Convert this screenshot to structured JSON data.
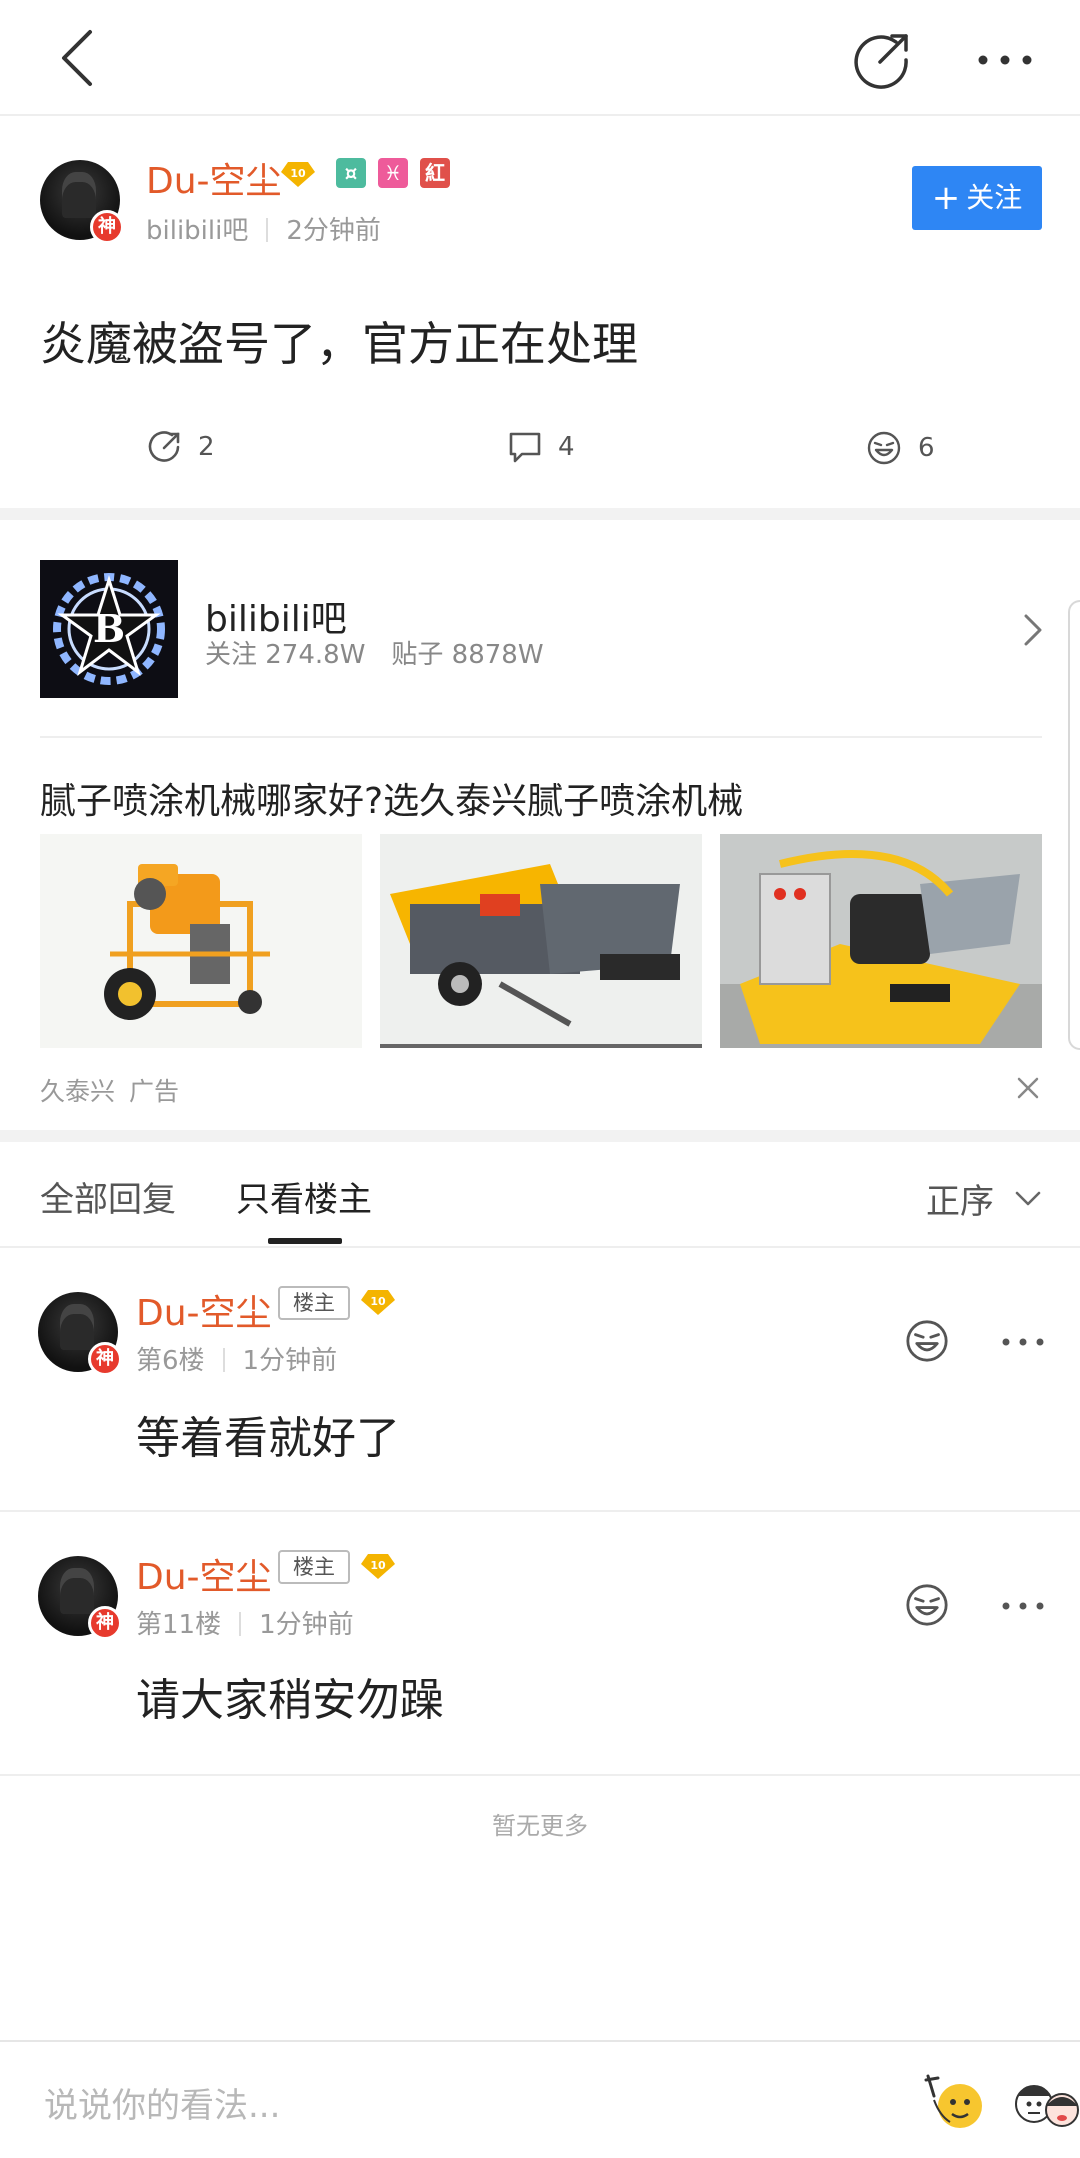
{
  "header": {
    "back_icon": "back-arrow-icon",
    "share_icon": "share-icon",
    "more_icon": "more-dots-icon"
  },
  "post": {
    "author": "Du-空尘",
    "level": "10",
    "tags": [
      "¤",
      "♓",
      "紅"
    ],
    "avatar_badge": "神",
    "forum": "bilibili吧",
    "time": "2分钟前",
    "follow_label": "关注",
    "follow_plus": "+",
    "title": "炎魔被盗号了，官方正在处理",
    "shares": "2",
    "comments": "4",
    "likes": "6"
  },
  "forum_card": {
    "name": "bilibili吧",
    "followers": "关注 274.8W",
    "posts": "贴子 8878W"
  },
  "ad": {
    "title": "腻子喷涂机械哪家好?选久泰兴腻子喷涂机械",
    "advertiser": "久泰兴",
    "label": "广告"
  },
  "tabs": {
    "all": "全部回复",
    "owner_only": "只看楼主",
    "sort": "正序"
  },
  "replies": [
    {
      "author": "Du-空尘",
      "owner_tag": "楼主",
      "level": "10",
      "avatar_badge": "神",
      "floor": "第6楼",
      "time": "1分钟前",
      "text": "等着看就好了"
    },
    {
      "author": "Du-空尘",
      "owner_tag": "楼主",
      "level": "10",
      "avatar_badge": "神",
      "floor": "第11楼",
      "time": "1分钟前",
      "text": "请大家稍安勿躁"
    }
  ],
  "no_more": "暂无更多",
  "composer": {
    "placeholder": "说说你的看法..."
  },
  "colors": {
    "username": "#e25a2a",
    "follow_button": "#2e86f4",
    "tag_green": "#4dbb9e",
    "tag_pink": "#ee5b9a",
    "tag_red": "#e0504a"
  }
}
